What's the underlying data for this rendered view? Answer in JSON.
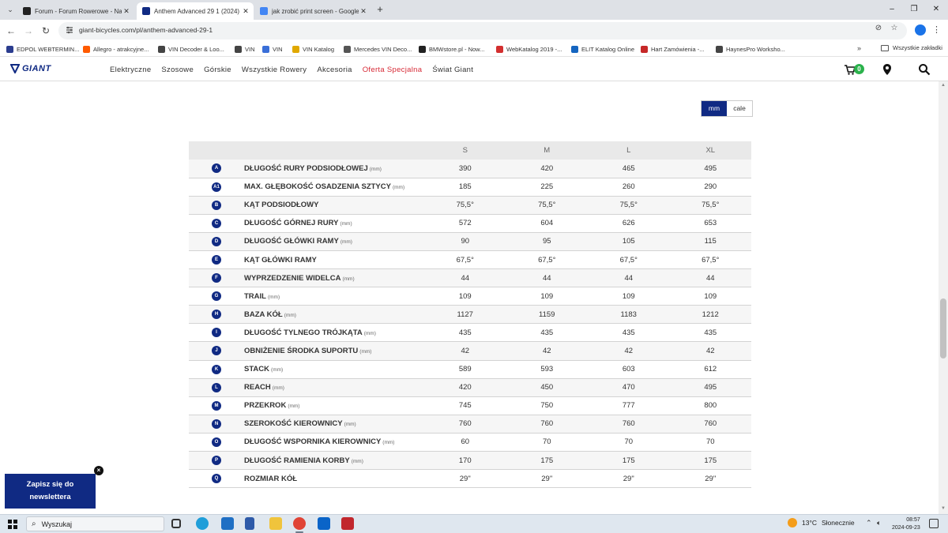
{
  "browser": {
    "tabs": [
      {
        "title": "Forum - Forum Rowerowe - Naj",
        "favicon_color": "#222222",
        "active": false
      },
      {
        "title": "Anthem Advanced 29 1 (2024) |",
        "favicon_color": "#102a83",
        "active": true
      },
      {
        "title": "jak zrobić print screen - Google",
        "favicon_color": "#4285f4",
        "active": false
      }
    ],
    "new_tab_label": "+",
    "url": "giant-bicycles.com/pl/anthem-advanced-29-1",
    "bookmarks": [
      {
        "label": "EDPOL WEBTERMIN...",
        "color": "#2b3d8f"
      },
      {
        "label": "Allegro - atrakcyjne...",
        "color": "#ff5a00"
      },
      {
        "label": "VIN Decoder & Loo...",
        "color": "#444444"
      },
      {
        "label": "VIN",
        "color": "#444444"
      },
      {
        "label": "VIN",
        "color": "#3a6fd8"
      },
      {
        "label": "VIN Katalog",
        "color": "#e0a800"
      },
      {
        "label": "Mercedes VIN Deco...",
        "color": "#555555"
      },
      {
        "label": "BMWstore.pl - Now...",
        "color": "#222222"
      },
      {
        "label": "WebKatalog 2019 -...",
        "color": "#d32f2f"
      },
      {
        "label": "ELIT Katalog Online",
        "color": "#1565c0"
      },
      {
        "label": "Hart Zamówienia -...",
        "color": "#c62828"
      },
      {
        "label": "HaynesPro Worksho...",
        "color": "#444444"
      }
    ],
    "all_bookmarks_label": "Wszystkie zakładki"
  },
  "site": {
    "logo_text": "GIANT",
    "brand_color": "#102a83",
    "special_color": "#d72a36",
    "nav": [
      {
        "label": "Elektryczne",
        "special": false
      },
      {
        "label": "Szosowe",
        "special": false
      },
      {
        "label": "Górskie",
        "special": false
      },
      {
        "label": "Wszystkie Rowery",
        "special": false
      },
      {
        "label": "Akcesoria",
        "special": false
      },
      {
        "label": "Oferta Specjalna",
        "special": true
      },
      {
        "label": "Świat Giant",
        "special": false
      }
    ],
    "cart_count": "0",
    "icons": [
      "cart-icon",
      "location-pin-icon",
      "search-icon"
    ]
  },
  "units": {
    "options": [
      "mm",
      "cale"
    ],
    "selected": "mm"
  },
  "geometry": {
    "sizes": [
      "S",
      "M",
      "L",
      "XL"
    ],
    "rows": [
      {
        "letter": "A",
        "name": "DŁUGOŚĆ RURY PODSIODŁOWEJ",
        "unit": "(mm)",
        "values": [
          "390",
          "420",
          "465",
          "495"
        ]
      },
      {
        "letter": "A1",
        "name": "MAX. GŁĘBOKOŚĆ OSADZENIA SZTYCY",
        "unit": "(mm)",
        "values": [
          "185",
          "225",
          "260",
          "290"
        ]
      },
      {
        "letter": "B",
        "name": "KĄT PODSIODŁOWY",
        "unit": "",
        "values": [
          "75,5°",
          "75,5°",
          "75,5°",
          "75,5°"
        ]
      },
      {
        "letter": "C",
        "name": "DŁUGOŚĆ GÓRNEJ RURY",
        "unit": "(mm)",
        "values": [
          "572",
          "604",
          "626",
          "653"
        ]
      },
      {
        "letter": "D",
        "name": "DŁUGOŚĆ GŁÓWKI RAMY",
        "unit": "(mm)",
        "values": [
          "90",
          "95",
          "105",
          "115"
        ]
      },
      {
        "letter": "E",
        "name": "KĄT GŁÓWKI RAMY",
        "unit": "",
        "values": [
          "67,5°",
          "67,5°",
          "67,5°",
          "67,5°"
        ]
      },
      {
        "letter": "F",
        "name": "WYPRZEDZENIE WIDELCA",
        "unit": "(mm)",
        "values": [
          "44",
          "44",
          "44",
          "44"
        ]
      },
      {
        "letter": "G",
        "name": "TRAIL",
        "unit": "(mm)",
        "values": [
          "109",
          "109",
          "109",
          "109"
        ]
      },
      {
        "letter": "H",
        "name": "BAZA KÓŁ",
        "unit": "(mm)",
        "values": [
          "1127",
          "1159",
          "1183",
          "1212"
        ]
      },
      {
        "letter": "I",
        "name": "DŁUGOŚĆ TYLNEGO TRÓJKĄTA",
        "unit": "(mm)",
        "values": [
          "435",
          "435",
          "435",
          "435"
        ]
      },
      {
        "letter": "J",
        "name": "OBNIŻENIE ŚRODKA SUPORTU",
        "unit": "(mm)",
        "values": [
          "42",
          "42",
          "42",
          "42"
        ]
      },
      {
        "letter": "K",
        "name": "STACK",
        "unit": "(mm)",
        "values": [
          "589",
          "593",
          "603",
          "612"
        ]
      },
      {
        "letter": "L",
        "name": "REACH",
        "unit": "(mm)",
        "values": [
          "420",
          "450",
          "470",
          "495"
        ]
      },
      {
        "letter": "M",
        "name": "PRZEKROK",
        "unit": "(mm)",
        "values": [
          "745",
          "750",
          "777",
          "800"
        ]
      },
      {
        "letter": "N",
        "name": "SZEROKOŚĆ KIEROWNICY",
        "unit": "(mm)",
        "values": [
          "760",
          "760",
          "760",
          "760"
        ]
      },
      {
        "letter": "O",
        "name": "DŁUGOŚĆ WSPORNIKA KIEROWNICY",
        "unit": "(mm)",
        "values": [
          "60",
          "70",
          "70",
          "70"
        ]
      },
      {
        "letter": "P",
        "name": "DŁUGOŚĆ RAMIENIA KORBY",
        "unit": "(mm)",
        "values": [
          "170",
          "175",
          "175",
          "175"
        ]
      },
      {
        "letter": "Q",
        "name": "ROZMIAR KÓŁ",
        "unit": "",
        "values": [
          "29\"",
          "29\"",
          "29\"",
          "29\""
        ]
      }
    ]
  },
  "newsletter": {
    "line1": "Zapisz się do",
    "line2": "newslettera",
    "close_label": "×"
  },
  "taskbar": {
    "search_placeholder": "Wyszukaj",
    "weather_temp": "13°C",
    "weather_desc": "Słonecznie",
    "time": "08:57",
    "date": "2024-09-23"
  }
}
